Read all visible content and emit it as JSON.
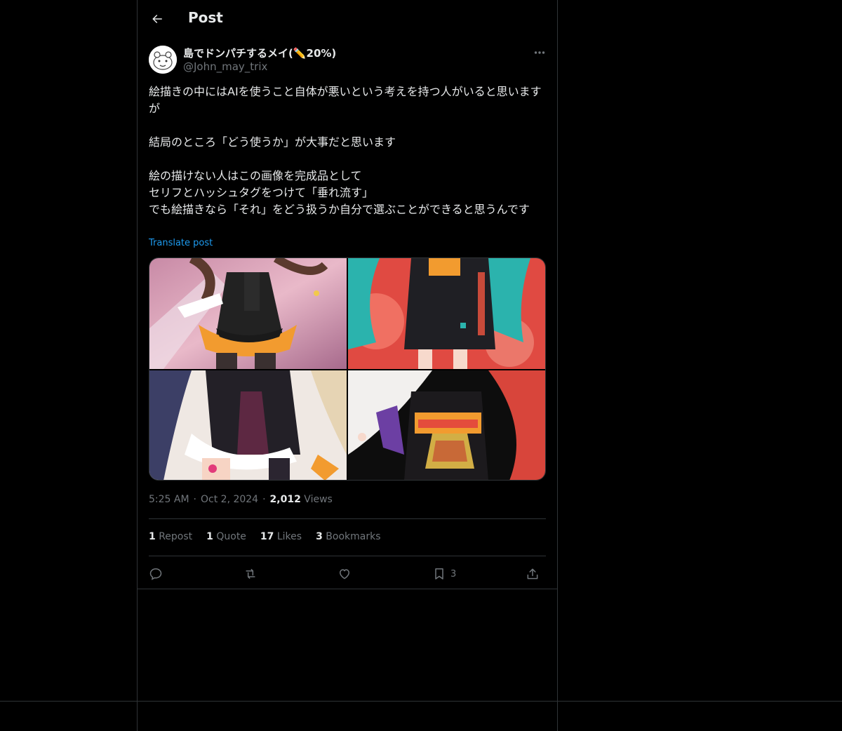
{
  "header": {
    "title": "Post",
    "back_icon": "arrow-left-icon"
  },
  "author": {
    "display_name": "島でドンパチするメイ(✏️20%)",
    "handle": "@John_may_trix"
  },
  "post": {
    "text": "絵描きの中にはAIを使うこと自体が悪いという考えを持つ人がいると思いますが\n\n結局のところ「どう使うか」が大事だと思います\n\n絵の描けない人はこの画像を完成品として\nセリフとハッシュタグをつけて「垂れ流す」\nでも絵描きなら「それ」をどう扱うか自分で選ぶことができると思うんです",
    "translate_label": "Translate post",
    "time": "5:25 AM",
    "date": "Oct 2, 2024",
    "views_count": "2,012",
    "views_label": "Views"
  },
  "stats": {
    "reposts_count": "1",
    "reposts_label": "Repost",
    "quotes_count": "1",
    "quotes_label": "Quote",
    "likes_count": "17",
    "likes_label": "Likes",
    "bookmarks_count": "3",
    "bookmarks_label": "Bookmarks"
  },
  "actions": {
    "reply_icon": "reply-icon",
    "repost_icon": "repost-icon",
    "like_icon": "heart-icon",
    "bookmark_icon": "bookmark-icon",
    "bookmark_count": "3",
    "share_icon": "share-icon"
  },
  "colors": {
    "background": "#000000",
    "text": "#e7e9ea",
    "muted": "#71767b",
    "link": "#1d9bf0",
    "divider": "#2f3336"
  }
}
